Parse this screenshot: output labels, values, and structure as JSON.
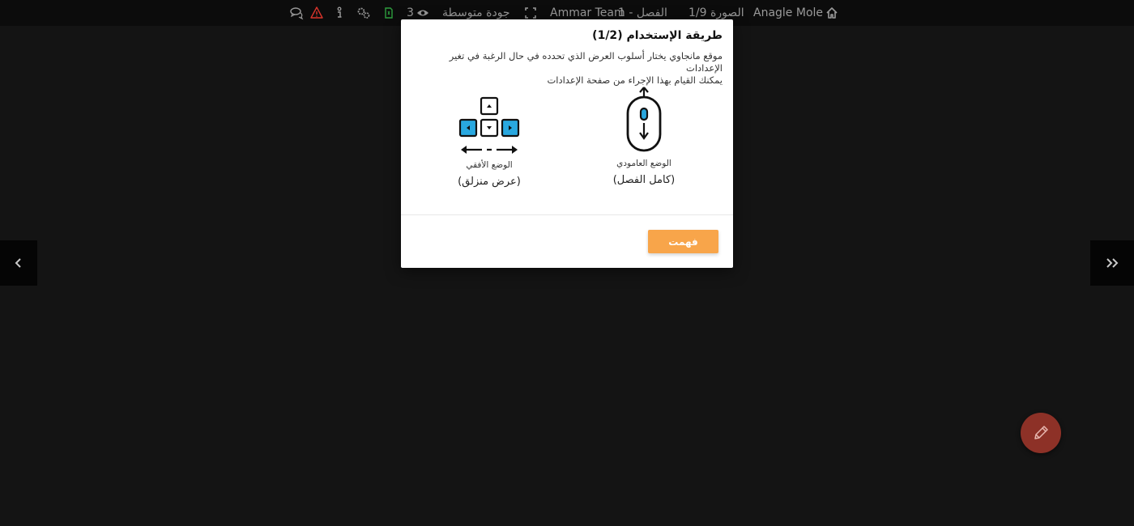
{
  "topbar": {
    "manga_title": "Anagle Mole",
    "page_indicator": "الصورة 1/9",
    "chapter": "الفصل - 1",
    "team": "Ammar Team",
    "quality": "جودة متوسطة",
    "views": "3",
    "icons": [
      "home-icon",
      "fullscreen-icon",
      "eye-icon",
      "file-icon",
      "settings-icon",
      "info-icon",
      "warning-icon",
      "comments-icon"
    ],
    "colors": {
      "file_icon": "#2e9e3e",
      "warning_icon": "#d9342b"
    }
  },
  "modal": {
    "title": "طريقة الإستخدام (1/2)",
    "description_line1": "موقع مانجاوي يختار أسلوب العرض الذي تحدده في حال الرغبة في تغير الإعدادات",
    "description_line2": "يمكنك القيام بهذا الإجراء من صفحة الإعدادات",
    "vertical_mode": {
      "label": "الوضع العامودي",
      "sub": "(كامل الفصل)"
    },
    "horizontal_mode": {
      "label": "الوضع الأفقي",
      "sub": "(عرض منزلق)"
    },
    "ok_button": "فهمت"
  },
  "colors": {
    "accent": "#f8a54a",
    "key_highlight": "#29a8e0",
    "fab": "#8d3127"
  }
}
